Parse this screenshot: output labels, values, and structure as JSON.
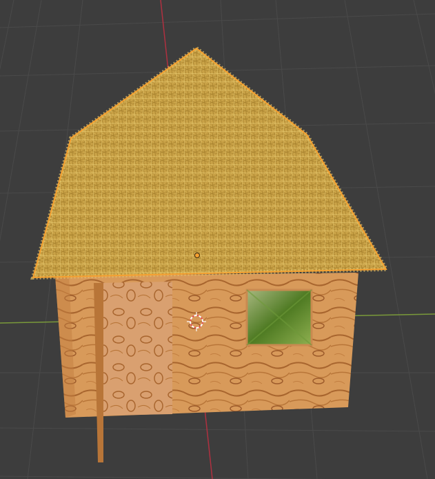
{
  "app": {
    "panel": "3D Viewport"
  },
  "colors": {
    "background": "#3d3d3d",
    "grid_line": "#4a4a4a",
    "x_axis": "#7a9a3a",
    "y_axis": "#b03040",
    "selection_outline": "#f5a030",
    "roof_base": "#c9a247",
    "roof_highlight": "#e3c46a",
    "wood_base": "#d89a5a",
    "wood_dark": "#9c5a2a",
    "window_green": "#6f9a3a"
  },
  "scene": {
    "object": "hut",
    "parts": [
      "thatched-roof",
      "wooden-walls",
      "door",
      "window"
    ],
    "selected": "thatched-roof",
    "cursor": "3d-cursor-icon"
  }
}
